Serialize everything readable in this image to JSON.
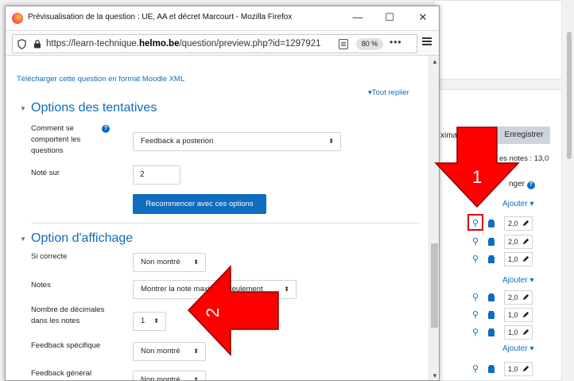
{
  "browser": {
    "title": "Prévisualisation de la question : UE, AA et décret Marcourt - Mozilla Firefox",
    "url_prefix": "https://learn-technique.",
    "url_domain": "helmo.be",
    "url_suffix": "/question/preview.php?id=1297921",
    "zoom": "80 %",
    "more": "•••",
    "minimize": "—",
    "maximize": "☐",
    "close": "✕"
  },
  "preview": {
    "export_link": "Télécharger cette question en format Moodle XML",
    "collapse_all": "Tout replier",
    "attempt_options": {
      "title": "Options des tentatives",
      "behaviour_label": "Comment se comportent les questions",
      "behaviour_value": "Feedback a posteriori",
      "marked_out_of_label": "Noté sur",
      "marked_out_of_value": "2",
      "restart_button": "Recommencer avec ces options"
    },
    "display_options": {
      "title": "Option d'affichage",
      "correct_label": "Si correcte",
      "correct_value": "Non montré",
      "marks_label": "Notes",
      "marks_value": "Montrer la note maximale seulement",
      "decimals_label": "Nombre de décimales dans les notes",
      "decimals_value": "1",
      "specific_feedback_label": "Feedback spécifique",
      "specific_feedback_value": "Non montré",
      "general_feedback_label": "Feedback général",
      "general_feedback_value": "Non montré"
    }
  },
  "background": {
    "partial_text": "ximale",
    "save_button": "Enregistrer",
    "total_marks": "es notes : 13,0",
    "change_label": "nger",
    "add_label": "Ajouter",
    "marks": [
      "2,0",
      "2,0",
      "1,0",
      "2,0",
      "1,0",
      "1,0",
      "1,0"
    ]
  },
  "annotations": {
    "arrow1_label": "1",
    "arrow2_label": "2",
    "arrow_color": "#ff0000"
  }
}
